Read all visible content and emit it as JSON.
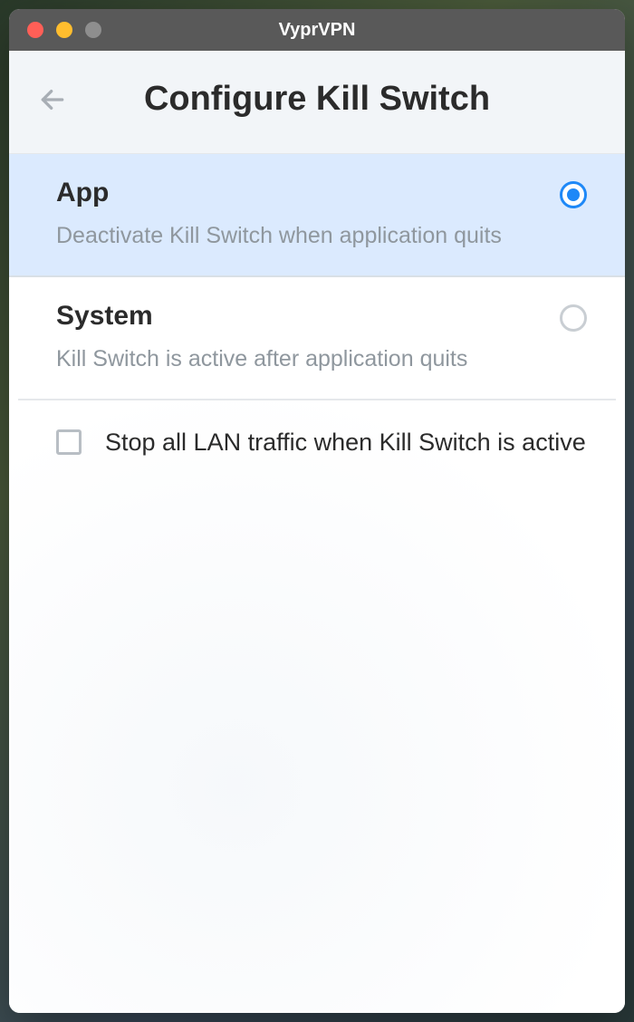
{
  "window": {
    "title": "VyprVPN"
  },
  "header": {
    "title": "Configure Kill Switch"
  },
  "options": [
    {
      "id": "app",
      "title": "App",
      "description": "Deactivate Kill Switch when application quits",
      "selected": true
    },
    {
      "id": "system",
      "title": "System",
      "description": "Kill Switch is active after application quits",
      "selected": false
    }
  ],
  "lan_checkbox": {
    "label": "Stop all LAN traffic when Kill Switch is active",
    "checked": false
  },
  "colors": {
    "accent": "#1e88f7",
    "selected_bg": "#dbeafe",
    "titlebar": "#595959",
    "header_bg": "#f2f5f8"
  }
}
